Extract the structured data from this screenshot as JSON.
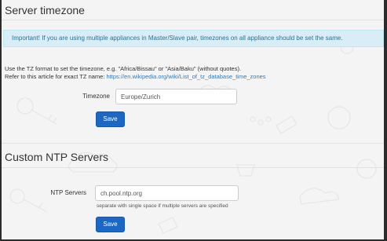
{
  "timezone_section": {
    "title": "Server timezone",
    "alert": "Important! If you are using multiple appliances in Master/Slave pair, timezones on all appliance should be set the same.",
    "help_line1": "Use the TZ format to set the timezone, e.g. \"Africa/Bissau\" or \"Asia/Baku\" (without quotes).",
    "help_line2_prefix": "Refer to this article for exact TZ name:",
    "help_link": "https://en.wikipedia.org/wiki/List_of_tz_database_time_zones",
    "field_label": "Timezone",
    "field_value": "Europe/Zurich",
    "save_label": "Save"
  },
  "ntp_section": {
    "title": "Custom NTP Servers",
    "field_label": "NTP Servers",
    "field_value": "ch.pool.ntp.org",
    "hint": "separate with single space if multiple servers are specified",
    "save_label": "Save"
  },
  "colors": {
    "page_bg": "#f4f4f4",
    "alert_bg": "#d9edf7",
    "alert_text": "#31708f",
    "button_bg": "#1c67c4",
    "link": "#337ab7"
  }
}
